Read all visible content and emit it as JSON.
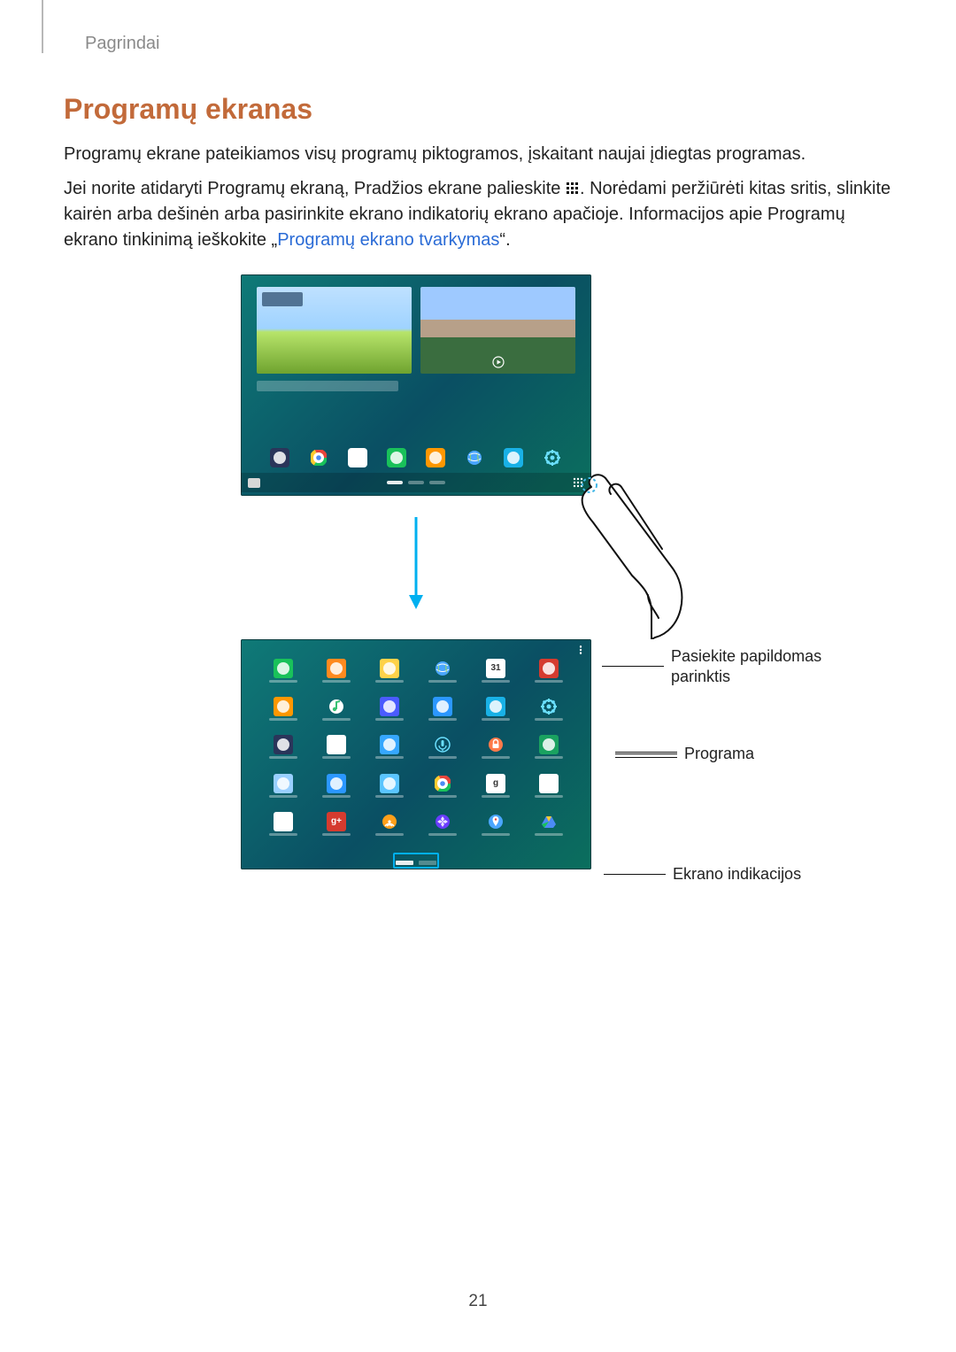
{
  "breadcrumb": "Pagrindai",
  "heading": "Programų ekranas",
  "para1": "Programų ekrane pateikiamos visų programų piktogramos, įskaitant naujai įdiegtas programas.",
  "para2_a": "Jei norite atidaryti Programų ekraną, Pradžios ekrane palieskite ",
  "para2_b": ". Norėdami peržiūrėti kitas sritis, slinkite kairėn arba dešinėn arba pasirinkite ekrano indikatorių ekrano apačioje. Informacijos apie Programų ekrano tinkinimą ieškokite „",
  "para2_link": "Programų ekrano tvarkymas",
  "para2_c": "“.",
  "callouts": {
    "more_options": "Pasiekite papildomas parinktis",
    "app": "Programa",
    "indicators": "Ekrano indikacijos"
  },
  "home_dock_icons": [
    {
      "name": "multi-app-icon",
      "bg": "#2a355a"
    },
    {
      "name": "chrome-icon",
      "bg": ""
    },
    {
      "name": "play-store-icon",
      "bg": "#ffffff"
    },
    {
      "name": "phone-icon",
      "bg": "#19c15a"
    },
    {
      "name": "email-icon",
      "bg": "#ff9700"
    },
    {
      "name": "internet-icon",
      "bg": ""
    },
    {
      "name": "gallery-icon",
      "bg": "#19b1e6"
    },
    {
      "name": "settings-icon",
      "bg": ""
    }
  ],
  "app_grid": [
    [
      {
        "name": "phone-icon",
        "bg": "#19c15a"
      },
      {
        "name": "contacts-icon",
        "bg": "#ff8a1f"
      },
      {
        "name": "my-files-icon",
        "bg": "#ffd24a"
      },
      {
        "name": "internet-icon",
        "bg": ""
      },
      {
        "name": "calendar-icon",
        "bg": "#ffffff",
        "text": "31"
      },
      {
        "name": "youtube-icon",
        "bg": "#d53b2f"
      }
    ],
    [
      {
        "name": "email-icon",
        "bg": "#ff9700"
      },
      {
        "name": "music-icon",
        "bg": ""
      },
      {
        "name": "video-icon",
        "bg": "#4b5bff"
      },
      {
        "name": "camera-icon",
        "bg": "#2b97ff"
      },
      {
        "name": "gallery-icon",
        "bg": "#19b1e6"
      },
      {
        "name": "settings-icon",
        "bg": ""
      }
    ],
    [
      {
        "name": "calculator-icon",
        "bg": "#2a355a"
      },
      {
        "name": "clock-icon",
        "bg": "#ffffff"
      },
      {
        "name": "help-icon",
        "bg": "#36a7ff"
      },
      {
        "name": "voice-rec-icon",
        "bg": ""
      },
      {
        "name": "lock-app-icon",
        "bg": ""
      },
      {
        "name": "hangouts-icon",
        "bg": "#1aa260"
      }
    ],
    [
      {
        "name": "office-icon",
        "bg": "#9ad0ff"
      },
      {
        "name": "s-health-icon",
        "bg": "#2b97ff"
      },
      {
        "name": "webex-icon",
        "bg": "#5bc5ff"
      },
      {
        "name": "chrome-icon",
        "bg": ""
      },
      {
        "name": "google-search-icon",
        "bg": "#ffffff",
        "text": "g"
      },
      {
        "name": "voice-search-icon",
        "bg": "#ffffff"
      }
    ],
    [
      {
        "name": "gmail-icon",
        "bg": "#ffffff"
      },
      {
        "name": "google-plus-icon",
        "bg": "#d53b2f",
        "text": "g+"
      },
      {
        "name": "podcast-icon",
        "bg": ""
      },
      {
        "name": "photos-icon",
        "bg": ""
      },
      {
        "name": "maps-icon",
        "bg": ""
      },
      {
        "name": "drive-icon",
        "bg": ""
      }
    ]
  ],
  "page_number": "21"
}
